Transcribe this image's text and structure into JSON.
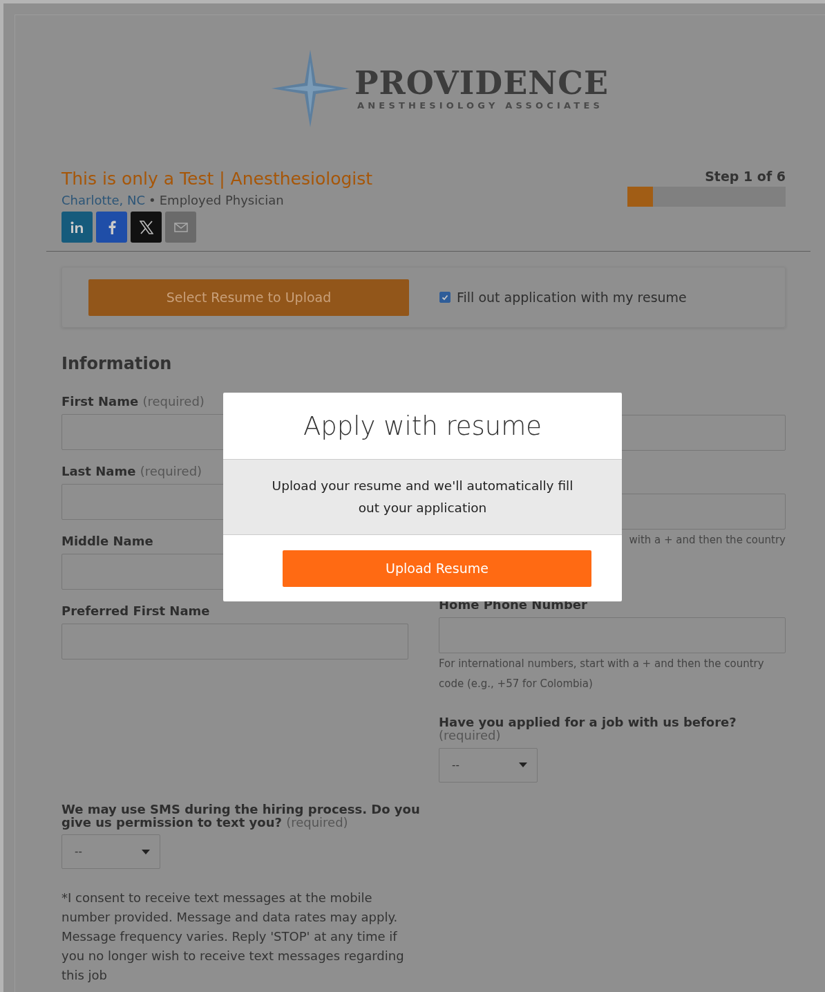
{
  "logo": {
    "name": "PROVIDENCE",
    "tagline": "ANESTHESIOLOGY ASSOCIATES"
  },
  "job": {
    "title": "This is only a Test | Anesthesiologist",
    "location": "Charlotte, NC",
    "separator": "•",
    "type": "Employed Physician"
  },
  "share_buttons": [
    {
      "kind": "linkedin"
    },
    {
      "kind": "facebook"
    },
    {
      "kind": "x"
    },
    {
      "kind": "email"
    }
  ],
  "progress": {
    "label": "Step 1 of 6",
    "level": 0.16
  },
  "resume_bar": {
    "button": "Select Resume to Upload",
    "checkbox": {
      "label": "Fill out application with my resume",
      "checked": true
    }
  },
  "section_title": "Information",
  "left_fields": [
    {
      "kind": "text",
      "label": "First Name",
      "required": "(required)"
    },
    {
      "kind": "text",
      "label": "Last Name",
      "required": "(required)"
    },
    {
      "kind": "text",
      "label": "Middle Name"
    },
    {
      "kind": "text",
      "label": "Preferred First Name"
    }
  ],
  "right_fields": [
    {
      "kind": "text"
    },
    {
      "kind": "text",
      "hint": "with a + and then the country"
    },
    {
      "kind": "text",
      "label": "Home Phone Number",
      "hint": "For international numbers, start with a + and then the country code (e.g., +57 for Colombia)"
    },
    {
      "kind": "select",
      "label": "Have you applied for a job with us before?",
      "required": "(required)",
      "value": "--"
    }
  ],
  "sms": {
    "label": "We may use SMS during the hiring process. Do you give us permission to text you?",
    "required": "(required)",
    "value": "--",
    "consent": "*I consent to receive text messages at the mobile number provided. Message and data rates may apply. Message frequency varies. Reply 'STOP' at any time if you no longer wish to receive text messages regarding this job"
  },
  "modal": {
    "title": "Apply with resume",
    "message": "Upload your resume and we'll automatically fill out your application",
    "button": "Upload Resume"
  }
}
